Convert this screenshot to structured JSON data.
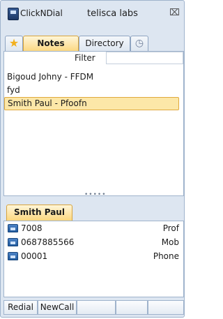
{
  "window": {
    "title": "ClickNDial",
    "company": "telisca labs",
    "close_icon": "close-icon"
  },
  "tabs": [
    {
      "label": "",
      "icon": "star-icon",
      "active": false
    },
    {
      "label": "Notes",
      "active": true
    },
    {
      "label": "Directory",
      "active": false
    },
    {
      "label": "",
      "icon": "history-icon",
      "active": false
    }
  ],
  "filter": {
    "label": "Filter",
    "value": ""
  },
  "notes_list": [
    {
      "text": "Bigoud Johny - FFDM",
      "selected": false
    },
    {
      "text": "fyd",
      "selected": false
    },
    {
      "text": "Smith Paul - Pfoofn",
      "selected": true
    }
  ],
  "contact": {
    "name": "Smith Paul",
    "phones": [
      {
        "number": "7008",
        "type": "Prof",
        "icon": "phone-icon"
      },
      {
        "number": "0687885566",
        "type": "Mob",
        "icon": "phone-icon"
      },
      {
        "number": "00001",
        "type": "Phone",
        "icon": "phone-icon"
      }
    ]
  },
  "bottom_buttons": [
    "Redial",
    "NewCall",
    "",
    "",
    ""
  ],
  "colors": {
    "accent": "#fcd77f",
    "selection": "#fce7a8",
    "window_bg": "#dde6f1",
    "phone_icon": "#215b9e"
  }
}
